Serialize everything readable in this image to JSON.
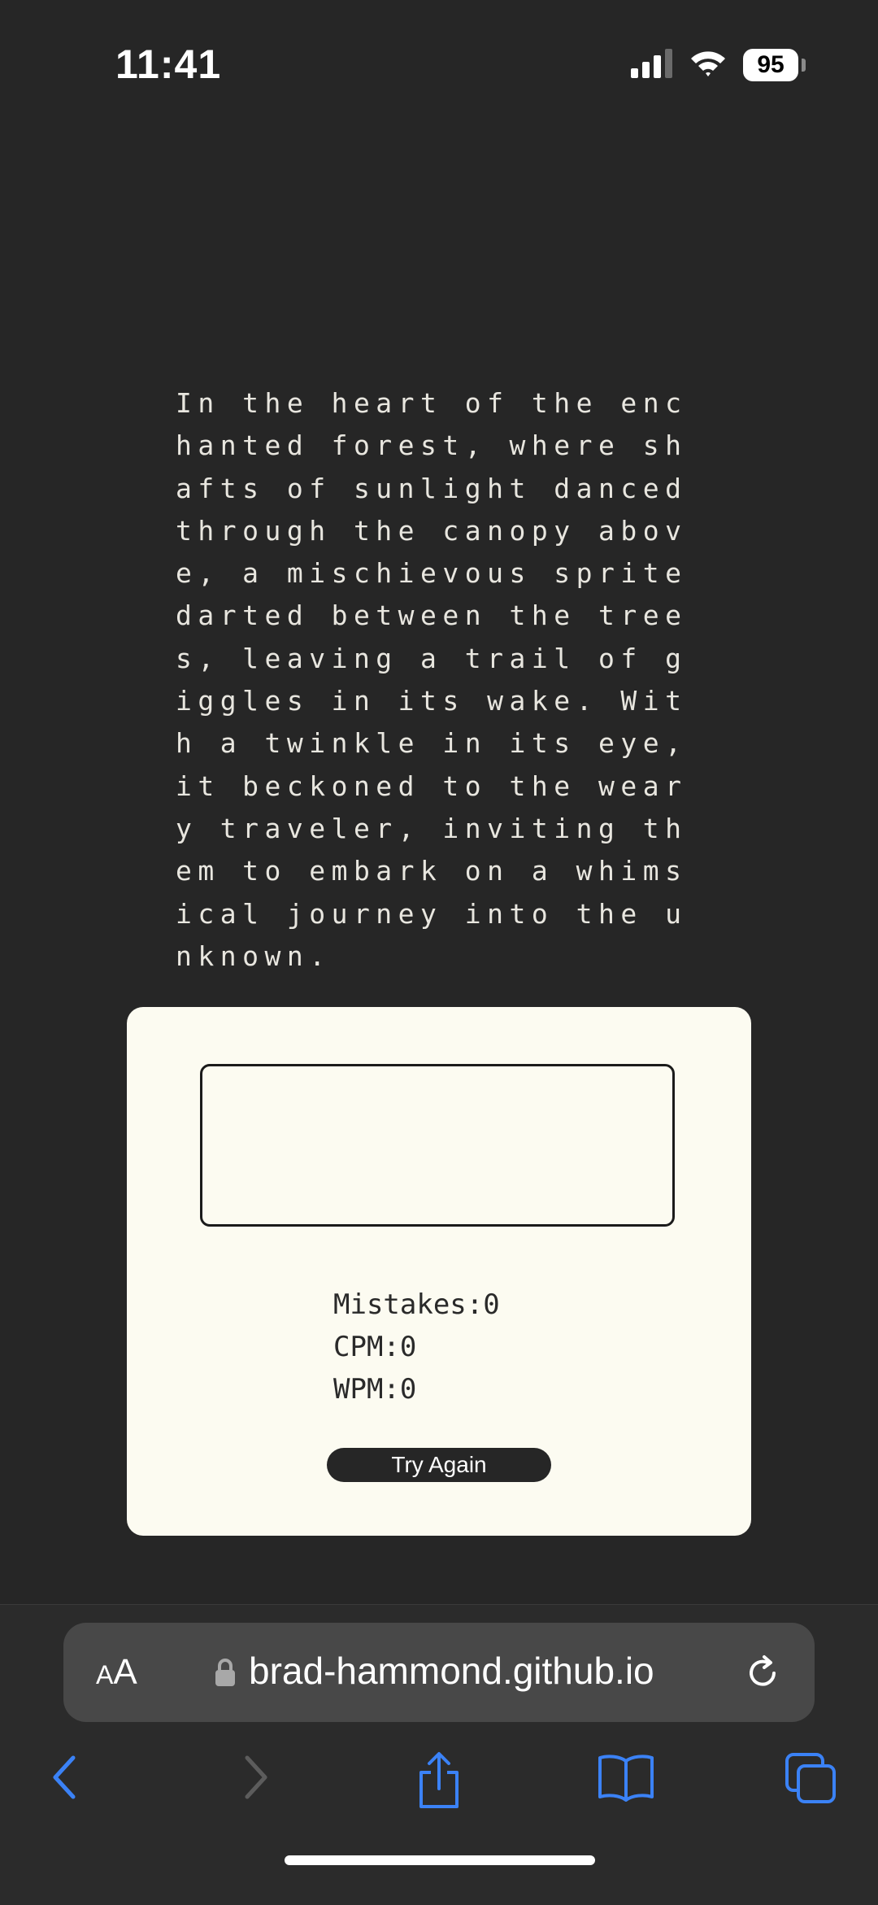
{
  "status": {
    "time": "11:41",
    "battery": "95"
  },
  "passage": "In the heart of the enchanted forest, where shafts of sunlight danced through the canopy above, a mischievous sprite darted between the trees, leaving a trail of giggles in its wake. With a twinkle in its eye, it beckoned to the weary traveler, inviting them to embark on a whimsical journey into the unknown.",
  "typing_input": {
    "value": ""
  },
  "stats": {
    "mistakes": "Mistakes:0",
    "cpm": "CPM:0",
    "wpm": "WPM:0"
  },
  "try_again_label": "Try Again",
  "browser": {
    "aa_big": "A",
    "aa_small": "A",
    "url": "brad-hammond.github.io"
  },
  "colors": {
    "accent": "#3b82f6",
    "background": "#262626",
    "card": "#fcfbf1"
  }
}
